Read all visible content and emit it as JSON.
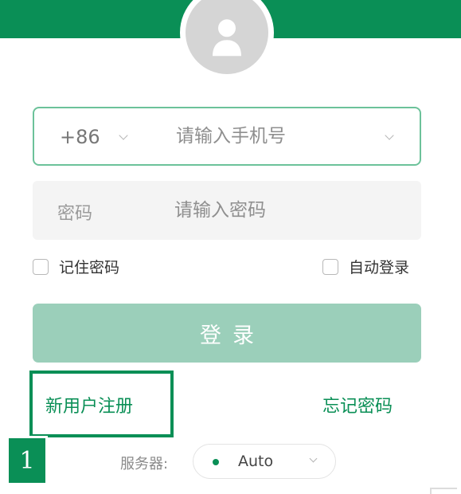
{
  "header": {
    "brand_color": "#0a8f56",
    "avatar_icon": "user-icon"
  },
  "login_form": {
    "country_code": "+86",
    "phone_placeholder": "请输入手机号",
    "password_label": "密码",
    "password_placeholder": "请输入密码",
    "remember_password_label": "记住密码",
    "remember_password_checked": false,
    "auto_login_label": "自动登录",
    "auto_login_checked": false,
    "login_button_label": "登录",
    "login_button_color": "#9bcfba"
  },
  "links": {
    "register_label": "新用户注册",
    "forgot_password_label": "忘记密码"
  },
  "annotation": {
    "step_number": "1"
  },
  "server": {
    "label": "服务器:",
    "value": "Auto",
    "status_color": "#0a8f56"
  }
}
